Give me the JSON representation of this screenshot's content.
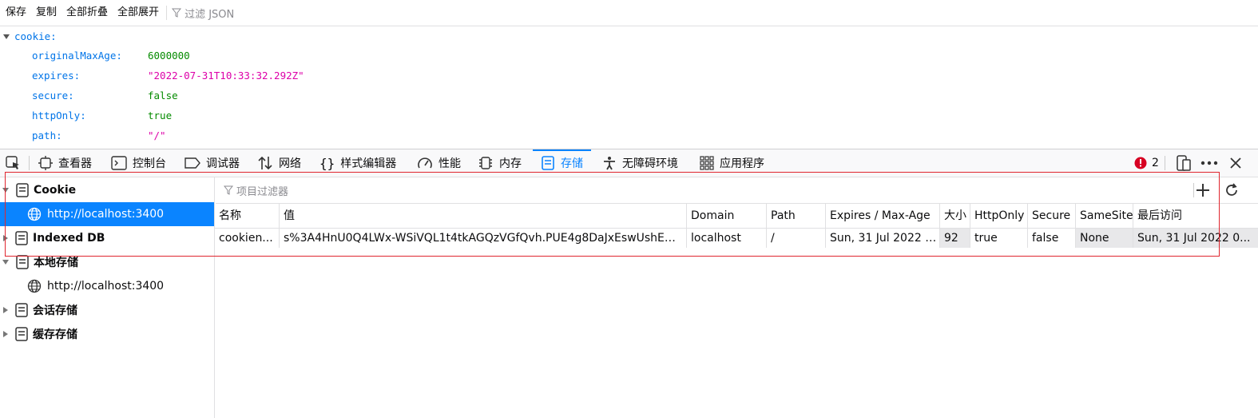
{
  "json_toolbar": {
    "save": "保存",
    "copy": "复制",
    "collapse_all": "全部折叠",
    "expand_all": "全部展开",
    "filter_placeholder": "过滤 JSON"
  },
  "json_tree": {
    "root_key": "cookie:",
    "rows": [
      {
        "key": "originalMaxAge:",
        "value": "6000000",
        "type": "number"
      },
      {
        "key": "expires:",
        "value": "\"2022-07-31T10:33:32.292Z\"",
        "type": "string"
      },
      {
        "key": "secure:",
        "value": "false",
        "type": "bool"
      },
      {
        "key": "httpOnly:",
        "value": "true",
        "type": "bool"
      },
      {
        "key": "path:",
        "value": "\"/\"",
        "type": "string"
      }
    ]
  },
  "devtools_tabs": {
    "inspector": "查看器",
    "console": "控制台",
    "debugger": "调试器",
    "network": "网络",
    "style_editor": "样式编辑器",
    "performance": "性能",
    "memory": "内存",
    "storage": "存储",
    "accessibility": "无障碍环境",
    "application": "应用程序",
    "error_count": "2"
  },
  "sidebar": {
    "cookie": "Cookie",
    "cookie_host": "http://localhost:3400",
    "indexed_db": "Indexed DB",
    "local_storage": "本地存储",
    "local_host": "http://localhost:3400",
    "session_storage": "会话存储",
    "cache_storage": "缓存存储"
  },
  "table": {
    "filter_placeholder": "项目过滤器",
    "headers": {
      "name": "名称",
      "value": "值",
      "domain": "Domain",
      "path": "Path",
      "expires": "Expires / Max-Age",
      "size": "大小",
      "httponly": "HttpOnly",
      "secure": "Secure",
      "samesite": "SameSite",
      "last_accessed": "最后访问"
    },
    "row": {
      "name": "cookien...",
      "value": "s%3A4HnU0Q4LWx-WSiVQL1t4tkAGQzVGfQvh.PUE4g8DaJxEswUshE%2B...",
      "domain": "localhost",
      "path": "/",
      "expires": "Sun, 31 Jul 2022 1...",
      "size": "92",
      "httponly": "true",
      "secure": "false",
      "samesite": "None",
      "last_accessed": "Sun, 31 Jul 2022 0..."
    }
  },
  "colors": {
    "accent": "#0a84ff",
    "highlight_box": "#e0262f",
    "json_key": "#0074e8",
    "json_string": "#dd00a9",
    "json_number": "#058b00",
    "error_badge": "#d70022"
  }
}
